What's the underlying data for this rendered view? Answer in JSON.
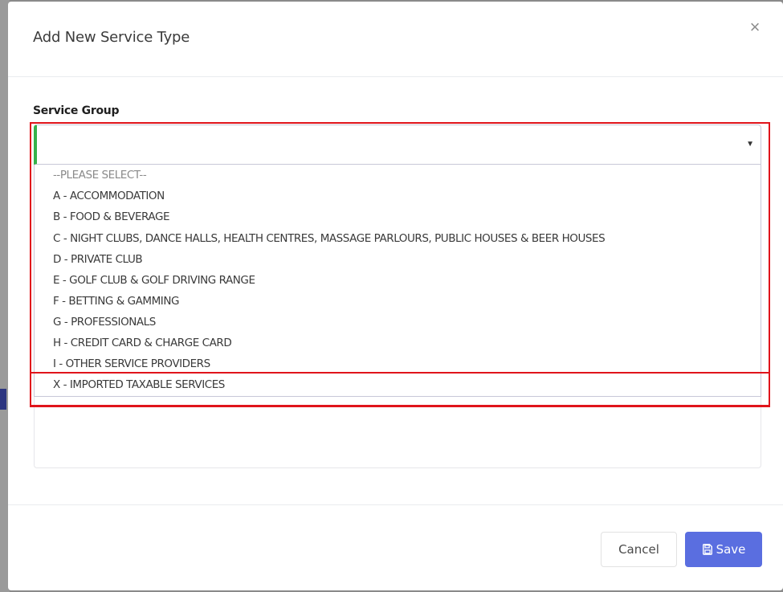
{
  "modal": {
    "title": "Add New Service Type",
    "close_icon": "close-icon"
  },
  "form": {
    "service_group_label": "Service Group",
    "selected_value": ""
  },
  "dropdown": {
    "options": [
      {
        "label": "--PLEASE SELECT--",
        "placeholder": true
      },
      {
        "label": "A - ACCOMMODATION"
      },
      {
        "label": "B - FOOD & BEVERAGE"
      },
      {
        "label": "C - NIGHT CLUBS, DANCE HALLS, HEALTH CENTRES, MASSAGE PARLOURS, PUBLIC HOUSES & BEER HOUSES"
      },
      {
        "label": "D - PRIVATE CLUB"
      },
      {
        "label": "E - GOLF CLUB & GOLF DRIVING RANGE"
      },
      {
        "label": "F - BETTING & GAMMING"
      },
      {
        "label": "G - PROFESSIONALS"
      },
      {
        "label": "H - CREDIT CARD & CHARGE CARD"
      },
      {
        "label": "I - OTHER SERVICE PROVIDERS"
      },
      {
        "label": "X - IMPORTED TAXABLE SERVICES"
      }
    ]
  },
  "footer": {
    "cancel_label": "Cancel",
    "save_label": "Save",
    "save_icon": "save-icon"
  },
  "colors": {
    "primary": "#5a6ee0",
    "focus_accent": "#36b24a",
    "annotation": "#e0141b"
  }
}
